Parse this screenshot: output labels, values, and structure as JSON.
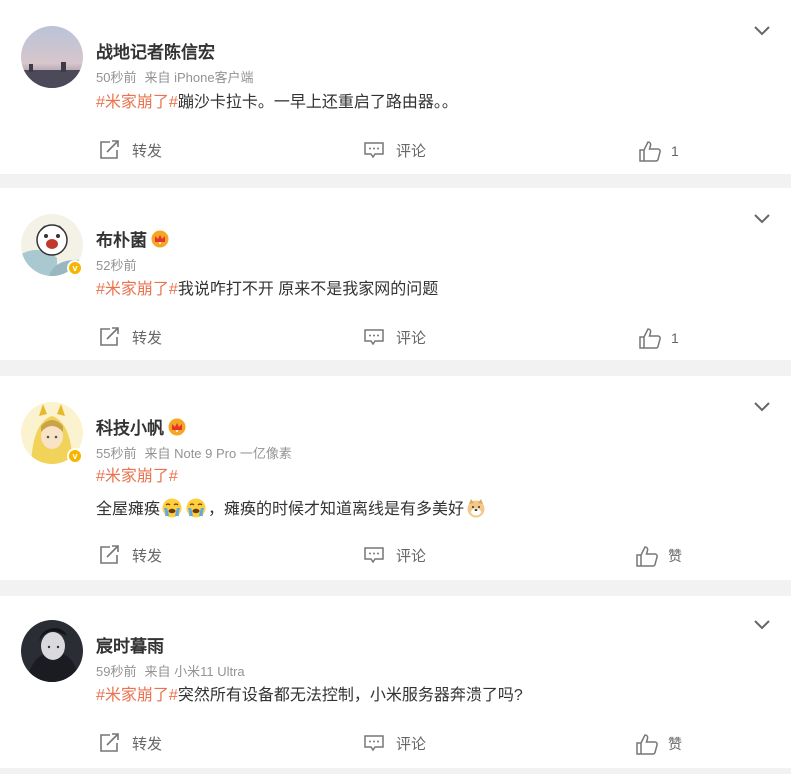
{
  "posts": [
    {
      "username": "战地记者陈信宏",
      "time": "50秒前",
      "source": "来自 iPhone客户端",
      "tag": "#米家崩了#",
      "text": "蹦沙卡拉卡。一早上还重启了路由器。。",
      "repost_label": "转发",
      "comment_label": "评论",
      "like_label": "1"
    },
    {
      "username": "布朴菌",
      "time": "52秒前",
      "source": "",
      "tag": "#米家崩了#",
      "text": "我说咋打不开 原来不是我家网的问题",
      "repost_label": "转发",
      "comment_label": "评论",
      "like_label": "1"
    },
    {
      "username": "科技小帆",
      "time": "55秒前",
      "source": "来自 Note 9 Pro 一亿像素",
      "tag": "#米家崩了#",
      "text_a": "全屋瘫痪",
      "text_b": "，瘫痪的时候才知道离线是有多美好",
      "repost_label": "转发",
      "comment_label": "评论",
      "like_label": "赞"
    },
    {
      "username": "宸时暮雨",
      "time": "59秒前",
      "source": "来自 小米11 Ultra",
      "tag": "#米家崩了#",
      "text": "突然所有设备都无法控制，小米服务器奔溃了吗?",
      "repost_label": "转发",
      "comment_label": "评论",
      "like_label": "赞"
    }
  ],
  "colors": {
    "accent": "#eb7350",
    "meta": "#939393",
    "background": "#f2f2f2",
    "verified": "#f7b500"
  },
  "icons": {
    "repost": "repost-icon",
    "comment": "comment-icon",
    "like": "thumbs-up-icon",
    "menu": "chevron-down-icon"
  }
}
